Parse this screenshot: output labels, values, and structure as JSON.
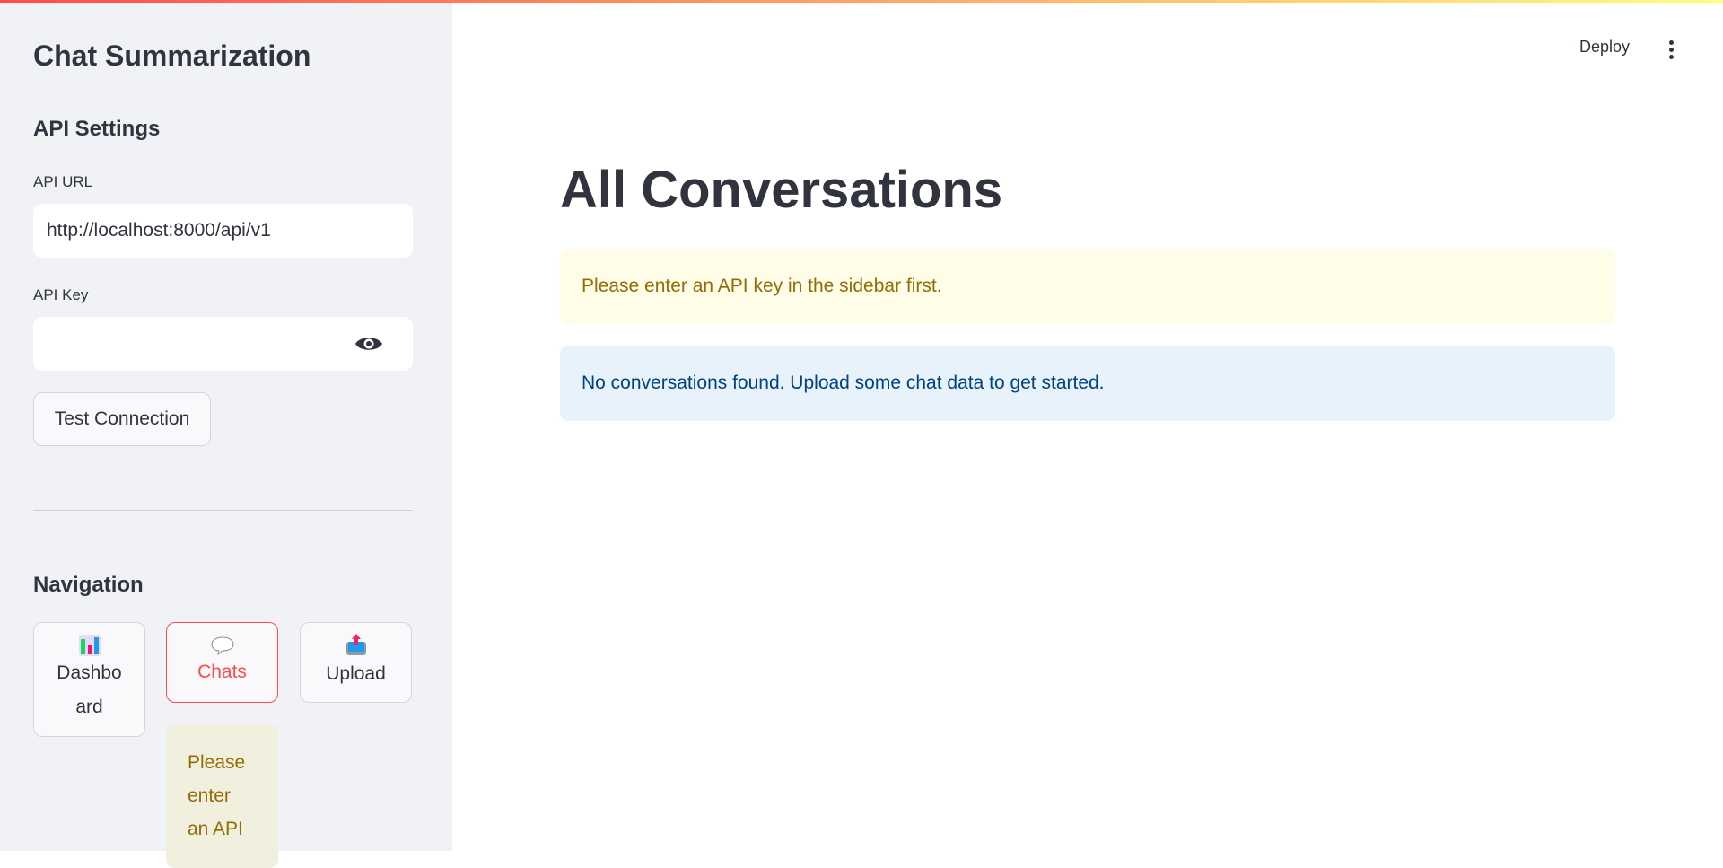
{
  "sidebar": {
    "title": "Chat Summarization",
    "api_settings_heading": "API Settings",
    "api_url_label": "API URL",
    "api_url_value": "http://localhost:8000/api/v1",
    "api_key_label": "API Key",
    "api_key_value": "",
    "test_connection_label": "Test Connection",
    "navigation_heading": "Navigation",
    "nav": [
      {
        "label": "Dashbo ard",
        "icon": "bar-chart-icon"
      },
      {
        "label": "Chats",
        "icon": "speech-bubble-icon",
        "active": true
      },
      {
        "label": "Upload",
        "icon": "outbox-tray-icon"
      }
    ],
    "nav_warning": "Please enter an API"
  },
  "header": {
    "deploy_label": "Deploy",
    "menu_icon": "kebab-menu-icon"
  },
  "main": {
    "title": "All Conversations",
    "warning": "Please enter an API key in the sidebar first.",
    "info": "No conversations found. Upload some chat data to get started."
  },
  "colors": {
    "accent": "#ff4b4b",
    "warning_bg": "#fffce7",
    "warning_text": "#926c05",
    "info_bg": "#e7f2fb",
    "info_text": "#004280"
  }
}
